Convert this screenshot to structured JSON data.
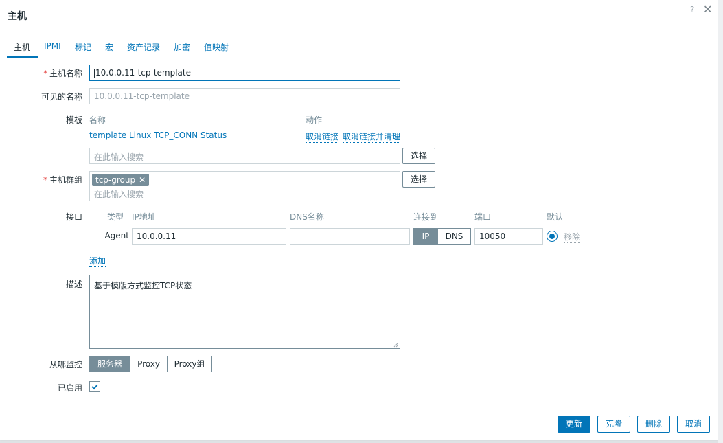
{
  "dialog": {
    "title": "主机",
    "help_icon": "?",
    "close_icon": "✕"
  },
  "tabs": [
    {
      "label": "主机",
      "active": true
    },
    {
      "label": "IPMI"
    },
    {
      "label": "标记"
    },
    {
      "label": "宏"
    },
    {
      "label": "资产记录"
    },
    {
      "label": "加密"
    },
    {
      "label": "值映射"
    }
  ],
  "host_name": {
    "label": "主机名称",
    "required_mark": "*",
    "value": "10.0.0.11-tcp-template"
  },
  "visible_name": {
    "label": "可见的名称",
    "value": "10.0.0.11-tcp-template"
  },
  "templates": {
    "label": "模板",
    "col_name": "名称",
    "col_action": "动作",
    "linked": [
      {
        "name": "template Linux TCP_CONN Status",
        "unlink": "取消链接",
        "unlink_clear": "取消链接并清理"
      }
    ],
    "search_placeholder": "在此输入搜索",
    "select_label": "选择"
  },
  "host_groups": {
    "label": "主机群组",
    "required_mark": "*",
    "chips": [
      {
        "label": "tcp-group",
        "remove": "✕"
      }
    ],
    "search_placeholder": "在此输入搜索",
    "select_label": "选择"
  },
  "interfaces": {
    "label": "接口",
    "headers": {
      "type": "类型",
      "ip": "IP地址",
      "dns": "DNS名称",
      "connect": "连接到",
      "port": "端口",
      "default": "默认"
    },
    "rows": [
      {
        "type": "Agent",
        "ip": "10.0.0.11",
        "dns": "",
        "connect_ip": "IP",
        "connect_dns": "DNS",
        "port": "10050",
        "remove": "移除"
      }
    ],
    "add_label": "添加"
  },
  "description": {
    "label": "描述",
    "value": "基于模版方式监控TCP状态"
  },
  "monitored_by": {
    "label": "从哪监控",
    "options": [
      "服务器",
      "Proxy",
      "Proxy组"
    ],
    "selected": "服务器"
  },
  "enabled": {
    "label": "已启用",
    "checked": true
  },
  "footer": {
    "update": "更新",
    "clone": "克隆",
    "delete": "删除",
    "cancel": "取消"
  },
  "colors": {
    "accent": "#0275b8",
    "required": "#e33734",
    "chip": "#768d99"
  }
}
